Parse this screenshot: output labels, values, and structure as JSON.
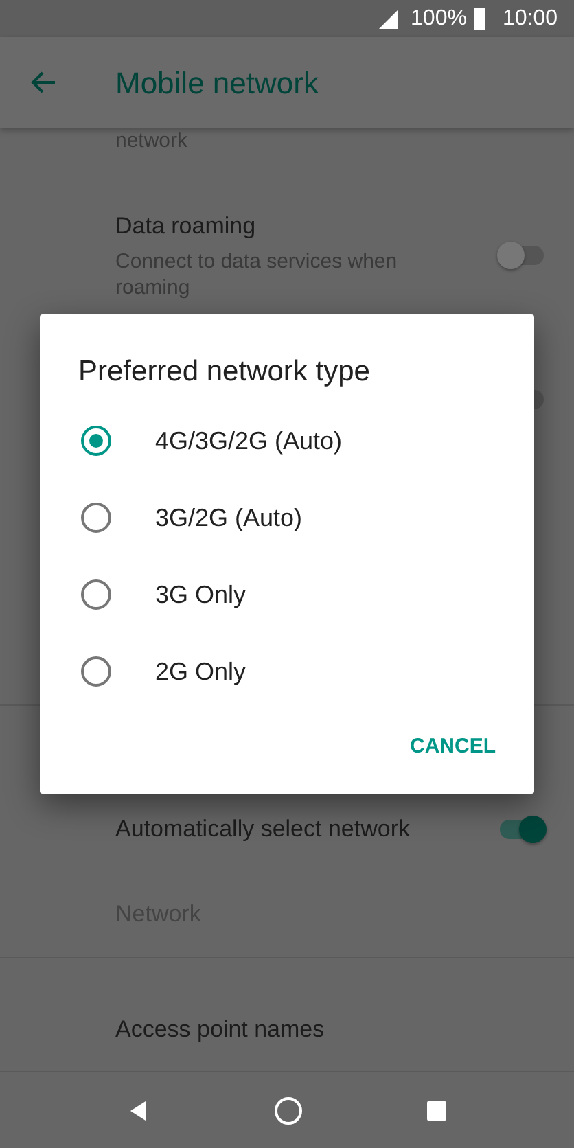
{
  "status_bar": {
    "battery": "100%",
    "time": "10:00"
  },
  "app_bar": {
    "title": "Mobile network"
  },
  "settings": [
    {
      "kind": "partial",
      "summary": "network"
    },
    {
      "kind": "switch",
      "title": "Data roaming",
      "summary": "Connect to data services when roaming",
      "on": false
    },
    {
      "kind": "hidden-switch",
      "on": false
    },
    {
      "kind": "divider"
    },
    {
      "kind": "switch",
      "title": "Automatically select network",
      "on": true
    },
    {
      "kind": "plain",
      "title": "Network",
      "disabled": true
    },
    {
      "kind": "divider"
    },
    {
      "kind": "plain",
      "title": "Access point names",
      "disabled": false
    }
  ],
  "dialog": {
    "title": "Preferred network type",
    "options": [
      {
        "label": "4G/3G/2G (Auto)",
        "selected": true
      },
      {
        "label": "3G/2G (Auto)",
        "selected": false
      },
      {
        "label": "3G Only",
        "selected": false
      },
      {
        "label": "2G Only",
        "selected": false
      }
    ],
    "button": "CANCEL"
  }
}
